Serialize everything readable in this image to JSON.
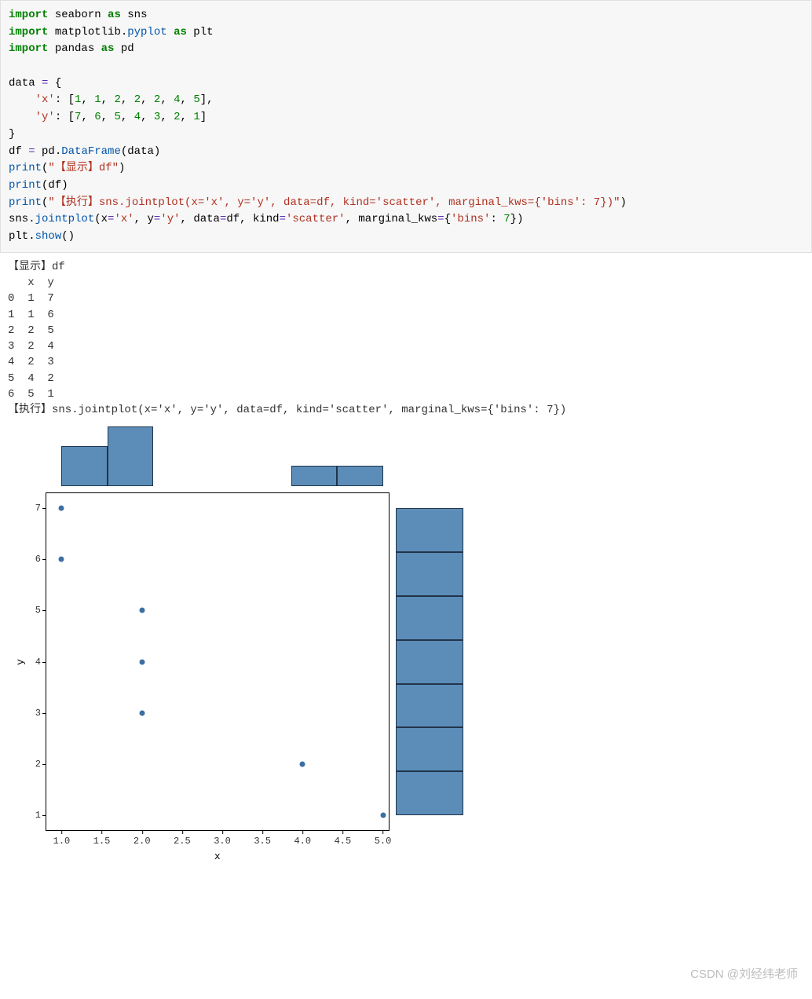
{
  "code": {
    "lines": [
      {
        "kind": "code",
        "tokens": [
          {
            "t": "kw",
            "v": "import"
          },
          {
            "t": "sp",
            "v": " "
          },
          {
            "t": "nm",
            "v": "seaborn "
          },
          {
            "t": "kw",
            "v": "as"
          },
          {
            "t": "sp",
            "v": " "
          },
          {
            "t": "nm",
            "v": "sns"
          }
        ]
      },
      {
        "kind": "code",
        "tokens": [
          {
            "t": "kw",
            "v": "import"
          },
          {
            "t": "sp",
            "v": " "
          },
          {
            "t": "nm",
            "v": "matplotlib."
          },
          {
            "t": "fn",
            "v": "pyplot"
          },
          {
            "t": "sp",
            "v": " "
          },
          {
            "t": "kw",
            "v": "as"
          },
          {
            "t": "sp",
            "v": " "
          },
          {
            "t": "nm",
            "v": "plt"
          }
        ]
      },
      {
        "kind": "code",
        "tokens": [
          {
            "t": "kw",
            "v": "import"
          },
          {
            "t": "sp",
            "v": " "
          },
          {
            "t": "nm",
            "v": "pandas "
          },
          {
            "t": "kw",
            "v": "as"
          },
          {
            "t": "sp",
            "v": " "
          },
          {
            "t": "nm",
            "v": "pd"
          }
        ]
      },
      {
        "kind": "blank"
      },
      {
        "kind": "code",
        "tokens": [
          {
            "t": "nm",
            "v": "data "
          },
          {
            "t": "op",
            "v": "="
          },
          {
            "t": "nm",
            "v": " {"
          }
        ]
      },
      {
        "kind": "code",
        "tokens": [
          {
            "t": "nm",
            "v": "    "
          },
          {
            "t": "str",
            "v": "'x'"
          },
          {
            "t": "nm",
            "v": ": ["
          },
          {
            "t": "num",
            "v": "1"
          },
          {
            "t": "nm",
            "v": ", "
          },
          {
            "t": "num",
            "v": "1"
          },
          {
            "t": "nm",
            "v": ", "
          },
          {
            "t": "num",
            "v": "2"
          },
          {
            "t": "nm",
            "v": ", "
          },
          {
            "t": "num",
            "v": "2"
          },
          {
            "t": "nm",
            "v": ", "
          },
          {
            "t": "num",
            "v": "2"
          },
          {
            "t": "nm",
            "v": ", "
          },
          {
            "t": "num",
            "v": "4"
          },
          {
            "t": "nm",
            "v": ", "
          },
          {
            "t": "num",
            "v": "5"
          },
          {
            "t": "nm",
            "v": "],"
          }
        ]
      },
      {
        "kind": "code",
        "tokens": [
          {
            "t": "nm",
            "v": "    "
          },
          {
            "t": "str",
            "v": "'y'"
          },
          {
            "t": "nm",
            "v": ": ["
          },
          {
            "t": "num",
            "v": "7"
          },
          {
            "t": "nm",
            "v": ", "
          },
          {
            "t": "num",
            "v": "6"
          },
          {
            "t": "nm",
            "v": ", "
          },
          {
            "t": "num",
            "v": "5"
          },
          {
            "t": "nm",
            "v": ", "
          },
          {
            "t": "num",
            "v": "4"
          },
          {
            "t": "nm",
            "v": ", "
          },
          {
            "t": "num",
            "v": "3"
          },
          {
            "t": "nm",
            "v": ", "
          },
          {
            "t": "num",
            "v": "2"
          },
          {
            "t": "nm",
            "v": ", "
          },
          {
            "t": "num",
            "v": "1"
          },
          {
            "t": "nm",
            "v": "]"
          }
        ]
      },
      {
        "kind": "code",
        "tokens": [
          {
            "t": "nm",
            "v": "}"
          }
        ]
      },
      {
        "kind": "code",
        "tokens": [
          {
            "t": "nm",
            "v": "df "
          },
          {
            "t": "op",
            "v": "="
          },
          {
            "t": "nm",
            "v": " pd."
          },
          {
            "t": "fn",
            "v": "DataFrame"
          },
          {
            "t": "nm",
            "v": "(data)"
          }
        ]
      },
      {
        "kind": "code",
        "tokens": [
          {
            "t": "fn",
            "v": "print"
          },
          {
            "t": "nm",
            "v": "("
          },
          {
            "t": "str",
            "v": "\"【显示】df\""
          },
          {
            "t": "nm",
            "v": ")"
          }
        ]
      },
      {
        "kind": "code",
        "tokens": [
          {
            "t": "fn",
            "v": "print"
          },
          {
            "t": "nm",
            "v": "(df)"
          }
        ]
      },
      {
        "kind": "code",
        "tokens": [
          {
            "t": "fn",
            "v": "print"
          },
          {
            "t": "nm",
            "v": "("
          },
          {
            "t": "str",
            "v": "\"【执行】sns.jointplot(x='x', y='y', data=df, kind='scatter', marginal_kws={'bins': 7})\""
          },
          {
            "t": "nm",
            "v": ")"
          }
        ]
      },
      {
        "kind": "code",
        "tokens": [
          {
            "t": "nm",
            "v": "sns."
          },
          {
            "t": "fn",
            "v": "jointplot"
          },
          {
            "t": "nm",
            "v": "(x"
          },
          {
            "t": "op",
            "v": "="
          },
          {
            "t": "str",
            "v": "'x'"
          },
          {
            "t": "nm",
            "v": ", y"
          },
          {
            "t": "op",
            "v": "="
          },
          {
            "t": "str",
            "v": "'y'"
          },
          {
            "t": "nm",
            "v": ", data"
          },
          {
            "t": "op",
            "v": "="
          },
          {
            "t": "nm",
            "v": "df, kind"
          },
          {
            "t": "op",
            "v": "="
          },
          {
            "t": "str",
            "v": "'scatter'"
          },
          {
            "t": "nm",
            "v": ", marginal_kws"
          },
          {
            "t": "op",
            "v": "="
          },
          {
            "t": "nm",
            "v": "{"
          },
          {
            "t": "str",
            "v": "'bins'"
          },
          {
            "t": "nm",
            "v": ": "
          },
          {
            "t": "num",
            "v": "7"
          },
          {
            "t": "nm",
            "v": "})"
          }
        ]
      },
      {
        "kind": "code",
        "tokens": [
          {
            "t": "nm",
            "v": "plt."
          },
          {
            "t": "fn",
            "v": "show"
          },
          {
            "t": "nm",
            "v": "()"
          }
        ]
      }
    ]
  },
  "output": {
    "header": "【显示】df",
    "cols": "   x  y",
    "rows": [
      "0  1  7",
      "1  1  6",
      "2  2  5",
      "3  2  4",
      "4  2  3",
      "5  4  2",
      "6  5  1"
    ],
    "exec_line": "【执行】sns.jointplot(x='x', y='y', data=df, kind='scatter', marginal_kws={'bins': 7})"
  },
  "chart_data": {
    "type": "scatter-joint",
    "scatter": {
      "x": [
        1,
        1,
        2,
        2,
        2,
        4,
        5
      ],
      "y": [
        7,
        6,
        5,
        4,
        3,
        2,
        1
      ],
      "xlim": [
        0.8,
        5.2
      ],
      "ylim": [
        0.7,
        7.3
      ],
      "xlabel": "x",
      "ylabel": "y",
      "xticks": [
        1.0,
        1.5,
        2.0,
        2.5,
        3.0,
        3.5,
        4.0,
        4.5,
        5.0
      ],
      "yticks": [
        1,
        2,
        3,
        4,
        5,
        6,
        7
      ]
    },
    "hist_x": {
      "bin_edges": [
        1.0,
        1.571,
        2.143,
        2.714,
        3.286,
        3.857,
        4.429,
        5.0
      ],
      "counts": [
        2,
        3,
        0,
        0,
        0,
        1,
        1
      ]
    },
    "hist_y": {
      "bin_edges": [
        1.0,
        1.857,
        2.714,
        3.571,
        4.429,
        5.286,
        6.143,
        7.0
      ],
      "counts": [
        1,
        1,
        1,
        1,
        1,
        1,
        1
      ]
    },
    "color": "#5b8db8"
  },
  "watermark": "CSDN @刘经纬老师"
}
